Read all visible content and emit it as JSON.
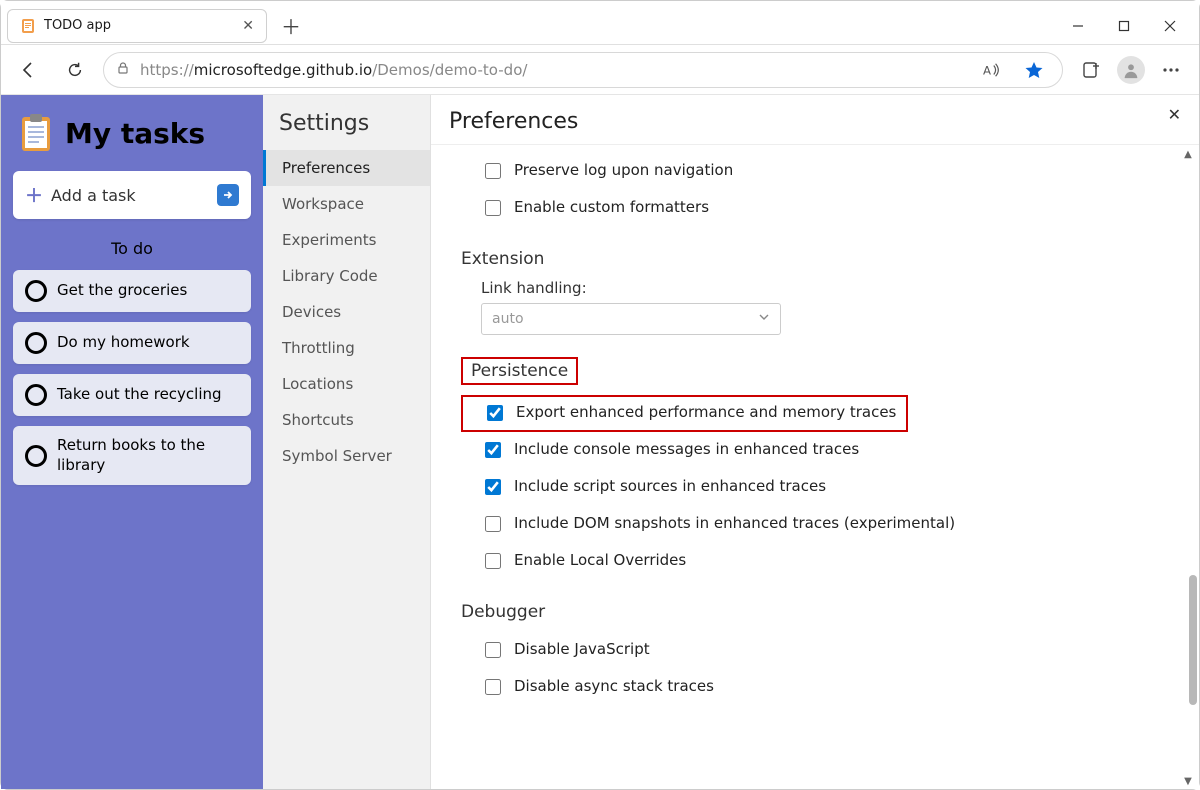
{
  "browser": {
    "tab_title": "TODO app",
    "url_proto": "https://",
    "url_host": "microsoftedge.github.io",
    "url_path": "/Demos/demo-to-do/"
  },
  "app": {
    "title": "My tasks",
    "add_task": "Add a task",
    "section": "To do",
    "tasks": [
      "Get the groceries",
      "Do my homework",
      "Take out the recycling",
      "Return books to the library"
    ]
  },
  "settings": {
    "title": "Settings",
    "items": [
      "Preferences",
      "Workspace",
      "Experiments",
      "Library Code",
      "Devices",
      "Throttling",
      "Locations",
      "Shortcuts",
      "Symbol Server"
    ],
    "active_index": 0
  },
  "panel": {
    "title": "Preferences",
    "top_checks": [
      {
        "label": "Preserve log upon navigation",
        "checked": false
      },
      {
        "label": "Enable custom formatters",
        "checked": false
      }
    ],
    "extension": {
      "title": "Extension",
      "link_label": "Link handling:",
      "link_value": "auto"
    },
    "persistence": {
      "title": "Persistence",
      "checks": [
        {
          "label": "Export enhanced performance and memory traces",
          "checked": true,
          "highlight": true
        },
        {
          "label": "Include console messages in enhanced traces",
          "checked": true
        },
        {
          "label": "Include script sources in enhanced traces",
          "checked": true
        },
        {
          "label": "Include DOM snapshots in enhanced traces (experimental)",
          "checked": false
        },
        {
          "label": "Enable Local Overrides",
          "checked": false
        }
      ]
    },
    "debugger": {
      "title": "Debugger",
      "checks": [
        {
          "label": "Disable JavaScript",
          "checked": false
        },
        {
          "label": "Disable async stack traces",
          "checked": false
        }
      ]
    }
  }
}
